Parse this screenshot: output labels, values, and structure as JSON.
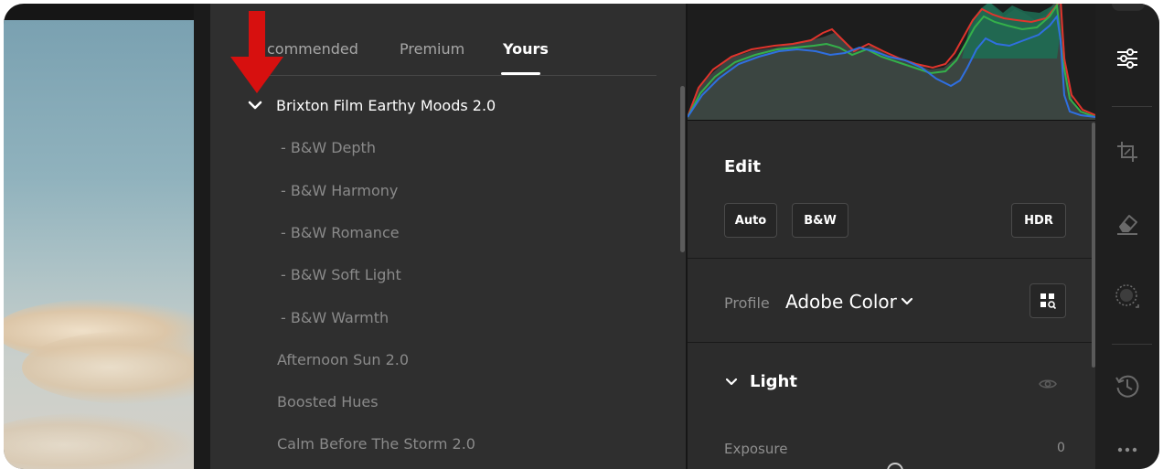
{
  "presets_panel": {
    "tabs": [
      {
        "label": "commended",
        "active": false
      },
      {
        "label": "Premium",
        "active": false
      },
      {
        "label": "Yours",
        "active": true
      }
    ],
    "group": {
      "label": "Brixton Film Earthy Moods 2.0",
      "expanded": true,
      "icon": "chevron-down-icon"
    },
    "presets": [
      "- B&W Depth",
      "- B&W Harmony",
      "- B&W Romance",
      "- B&W Soft Light",
      "- B&W Warmth",
      "Afternoon Sun 2.0",
      "Boosted Hues",
      "Calm Before The Storm 2.0"
    ],
    "annotation": {
      "icon": "red-arrow-down-icon",
      "color": "#d7100f"
    }
  },
  "edit_panel": {
    "title": "Edit",
    "buttons": {
      "auto": "Auto",
      "bw": "B&W",
      "hdr": "HDR"
    },
    "profile": {
      "label": "Profile",
      "value": "Adobe Color",
      "browse_icon": "profile-browser-icon"
    },
    "light": {
      "label": "Light",
      "expanded": true,
      "visibility_icon": "eye-icon"
    },
    "exposure": {
      "label": "Exposure",
      "value": "0"
    }
  },
  "tool_rail": {
    "items": [
      {
        "icon": "edit-sliders-icon",
        "active": true
      },
      {
        "icon": "crop-icon",
        "active": false
      },
      {
        "icon": "healing-eraser-icon",
        "active": false
      },
      {
        "icon": "masking-icon",
        "active": false
      },
      {
        "icon": "history-icon",
        "active": false
      },
      {
        "icon": "more-icon",
        "active": false
      }
    ]
  },
  "colors": {
    "accent_red": "#d7100f",
    "panel_bg": "#2f2f2f",
    "histogram_red": "#e0342c",
    "histogram_green": "#34b04a",
    "histogram_blue": "#2f6fe0"
  }
}
